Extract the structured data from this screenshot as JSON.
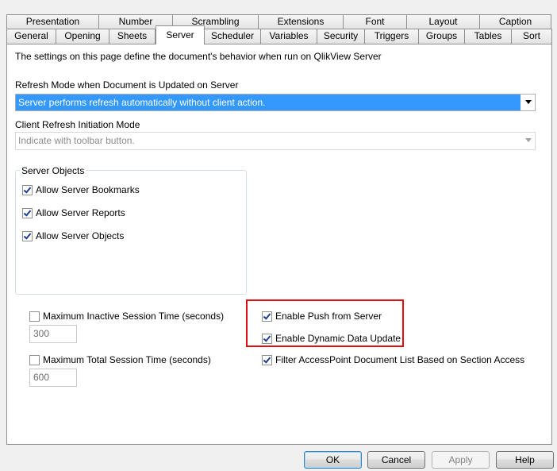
{
  "tabs_row1": [
    "Presentation",
    "Number",
    "Scrambling",
    "Extensions",
    "Font",
    "Layout",
    "Caption"
  ],
  "tabs_row2": [
    "General",
    "Opening",
    "Sheets",
    "Server",
    "Scheduler",
    "Variables",
    "Security",
    "Triggers",
    "Groups",
    "Tables",
    "Sort"
  ],
  "active_tab": "Server",
  "description": "The settings on this page define the document's behavior when run on QlikView Server",
  "refresh_mode": {
    "label": "Refresh Mode when Document is Updated on Server",
    "value": "Server performs refresh automatically without client action."
  },
  "client_refresh": {
    "label": "Client Refresh Initiation Mode",
    "value": "Indicate with toolbar button."
  },
  "server_objects": {
    "title": "Server Objects",
    "items": [
      {
        "label": "Allow Server Bookmarks",
        "checked": true
      },
      {
        "label": "Allow Server Reports",
        "checked": true
      },
      {
        "label": "Allow Server Objects",
        "checked": true
      }
    ]
  },
  "max_inactive": {
    "label": "Maximum Inactive Session Time (seconds)",
    "checked": false,
    "value": "300"
  },
  "max_total": {
    "label": "Maximum Total Session Time (seconds)",
    "checked": false,
    "value": "600"
  },
  "push_from_server": {
    "label": "Enable Push from Server",
    "checked": true
  },
  "dynamic_data": {
    "label": "Enable Dynamic Data Update",
    "checked": true
  },
  "filter_accesspoint": {
    "label": "Filter AccessPoint Document List Based on Section Access",
    "checked": true
  },
  "buttons": {
    "ok": "OK",
    "cancel": "Cancel",
    "apply": "Apply",
    "help": "Help"
  },
  "colors": {
    "highlight": "#3399ff",
    "annotation": "#e01010"
  }
}
